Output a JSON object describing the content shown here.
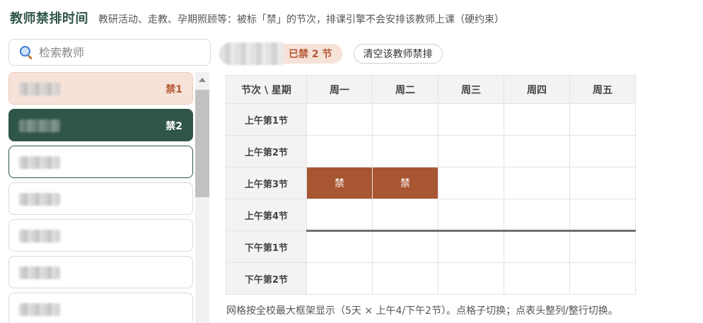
{
  "header": {
    "title": "教师禁排时间",
    "description": "教研活动、走教、孕期照顾等：被标「禁」的节次，排课引擎不会安排该教师上课（硬约束）"
  },
  "search": {
    "placeholder": "检索教师",
    "value": ""
  },
  "teacher_list": [
    {
      "badge": "禁1",
      "style": "light"
    },
    {
      "badge": "禁2",
      "style": "dark"
    },
    {
      "badge": "",
      "style": "focused"
    },
    {
      "badge": "",
      "style": "normal"
    },
    {
      "badge": "",
      "style": "normal"
    },
    {
      "badge": "",
      "style": "normal"
    },
    {
      "badge": "",
      "style": "normal"
    }
  ],
  "toolbar": {
    "count_label": "已禁 2 节",
    "clear_button": "清空该教师禁排"
  },
  "grid": {
    "corner": "节次 \\ 星期",
    "days": [
      "周一",
      "周二",
      "周三",
      "周四",
      "周五"
    ],
    "periods": [
      "上午第1节",
      "上午第2节",
      "上午第3节",
      "上午第4节",
      "下午第1节",
      "下午第2节"
    ],
    "banned_label": "禁",
    "cells": [
      [
        "",
        "",
        "",
        "",
        ""
      ],
      [
        "",
        "",
        "",
        "",
        ""
      ],
      [
        "禁",
        "禁",
        "",
        "",
        ""
      ],
      [
        "",
        "",
        "",
        "",
        ""
      ],
      [
        "",
        "",
        "",
        "",
        ""
      ],
      [
        "",
        "",
        "",
        "",
        ""
      ]
    ]
  },
  "colors": {
    "brand_dark": "#2f5548",
    "banned_fill": "#a85532",
    "badge_light_bg": "#f6e2d9",
    "badge_text": "#b35a35"
  },
  "footnote": "网格按全校最大框架显示（5天 × 上午4/下午2节）。点格子切换；点表头整列/整行切换。"
}
